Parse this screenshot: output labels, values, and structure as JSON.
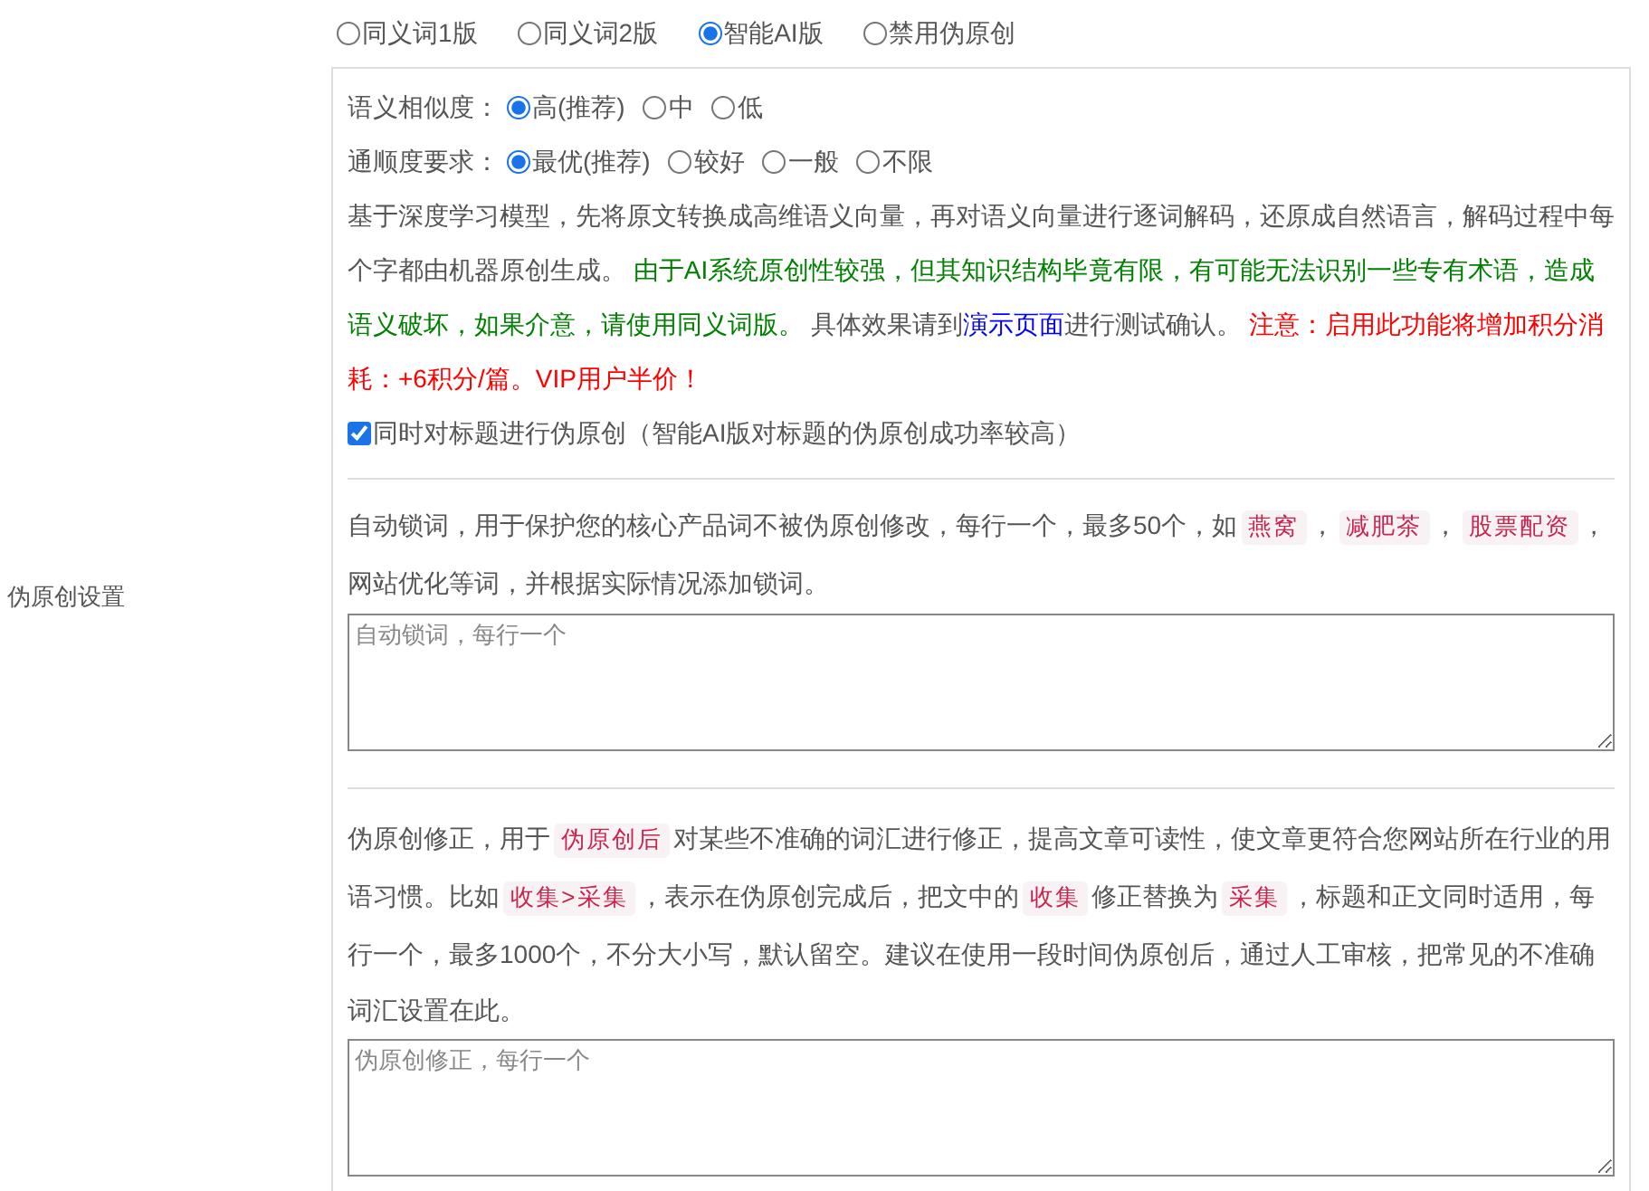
{
  "side_label": "伪原创设置",
  "mode_options": [
    {
      "label": "同义词1版",
      "selected": false
    },
    {
      "label": "同义词2版",
      "selected": false
    },
    {
      "label": "智能AI版",
      "selected": true
    },
    {
      "label": "禁用伪原创",
      "selected": false
    }
  ],
  "similarity": {
    "label": "语义相似度：",
    "options": [
      {
        "label": "高(推荐)",
        "selected": true
      },
      {
        "label": "中",
        "selected": false
      },
      {
        "label": "低",
        "selected": false
      }
    ]
  },
  "fluency": {
    "label": "通顺度要求：",
    "options": [
      {
        "label": "最优(推荐)",
        "selected": true
      },
      {
        "label": "较好",
        "selected": false
      },
      {
        "label": "一般",
        "selected": false
      },
      {
        "label": "不限",
        "selected": false
      }
    ]
  },
  "ai_description": [
    {
      "kind": "text",
      "text": "基于深度学习模型，先将原文转换成高维语义向量，再对语义向量进行逐词解码，还原成自然语言，解码过程中每个字都由机器原创生成。 "
    },
    {
      "kind": "notice",
      "text": "由于AI系统原创性较强，但其知识结构毕竟有限，有可能无法识别一些专有术语，造成语义破坏，如果介意，请使用同义词版。"
    },
    {
      "kind": "text",
      "text": " 具体效果请到"
    },
    {
      "kind": "link",
      "text": "演示页面"
    },
    {
      "kind": "text",
      "text": "进行测试确认。 "
    },
    {
      "kind": "warning",
      "text": "注意：启用此功能将增加积分消耗：+6积分/篇。VIP用户半价！"
    }
  ],
  "title_checkbox": {
    "label": "同时对标题进行伪原创（智能AI版对标题的伪原创成功率较高）",
    "checked": true
  },
  "auto_lock": {
    "description": [
      {
        "kind": "text",
        "text": "自动锁词，用于保护您的核心产品词不被伪原创修改，每行一个，最多50个，如"
      },
      {
        "kind": "tag",
        "text": "燕窝"
      },
      {
        "kind": "text",
        "text": "，"
      },
      {
        "kind": "tag",
        "text": "减肥茶"
      },
      {
        "kind": "text",
        "text": "，"
      },
      {
        "kind": "tag",
        "text": "股票配资"
      },
      {
        "kind": "text",
        "text": "，网站优化等词，并根据实际情况添加锁词。"
      }
    ],
    "placeholder": "自动锁词，每行一个"
  },
  "correction": {
    "description": [
      {
        "kind": "text",
        "text": "伪原创修正，用于"
      },
      {
        "kind": "tag",
        "text": "伪原创后"
      },
      {
        "kind": "text",
        "text": "对某些不准确的词汇进行修正，提高文章可读性，使文章更符合您网站所在行业的用语习惯。比如"
      },
      {
        "kind": "tag",
        "text": "收集>采集"
      },
      {
        "kind": "text",
        "text": "，表示在伪原创完成后，把文中的"
      },
      {
        "kind": "tag",
        "text": "收集"
      },
      {
        "kind": "text",
        "text": "修正替换为"
      },
      {
        "kind": "tag",
        "text": "采集"
      },
      {
        "kind": "text",
        "text": "，标题和正文同时适用，每行一个，最多1000个，不分大小写，默认留空。建议在使用一段时间伪原创后，通过人工审核，把常见的不准确词汇设置在此。"
      }
    ],
    "placeholder": "伪原创修正，每行一个"
  }
}
